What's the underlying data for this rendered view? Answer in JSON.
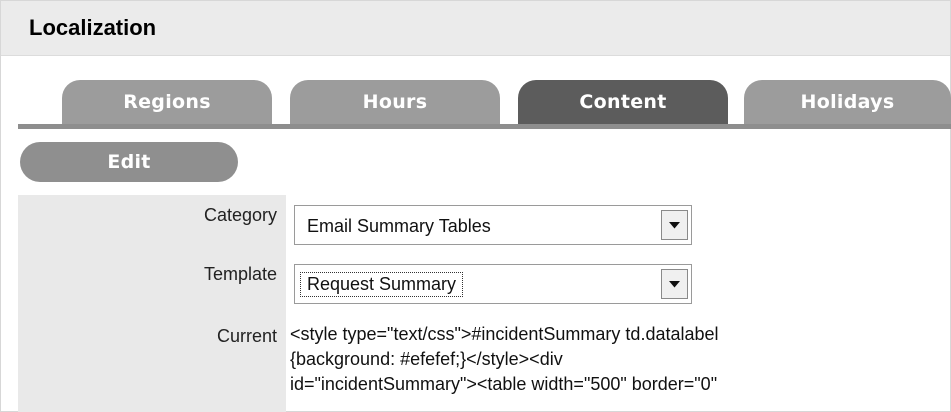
{
  "page": {
    "title": "Localization"
  },
  "tabs": [
    {
      "label": "Regions",
      "active": false
    },
    {
      "label": "Hours",
      "active": false
    },
    {
      "label": "Content",
      "active": true
    },
    {
      "label": "Holidays",
      "active": false
    }
  ],
  "toolbar": {
    "edit_label": "Edit"
  },
  "form": {
    "category": {
      "label": "Category",
      "value": "Email Summary Tables"
    },
    "template": {
      "label": "Template",
      "value": "Request Summary"
    },
    "current": {
      "label": "Current",
      "lines": [
        "<style type=\"text/css\">#incidentSummary td.datalabel",
        "{background: #efefef;}</style><div",
        "id=\"incidentSummary\"><table width=\"500\" border=\"0\""
      ]
    }
  },
  "colors": {
    "tab_inactive": "#9c9c9c",
    "tab_active": "#5c5c5c",
    "header_bg": "#ebebeb",
    "label_column_bg": "#e9e9e9"
  },
  "icons": {
    "dropdown": "chevron-down-icon"
  }
}
